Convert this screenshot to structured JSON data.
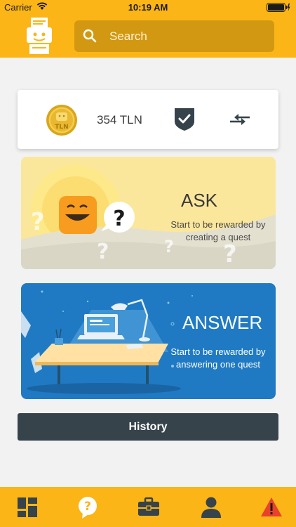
{
  "status_bar": {
    "carrier": "Carrier",
    "time": "10:19 AM"
  },
  "header": {
    "search_placeholder": "Search",
    "logo_icon": "printer-robot-icon"
  },
  "wallet": {
    "balance": "354 TLN",
    "coin_label": "TLN",
    "verified_icon": "shield-check-icon",
    "swap_icon": "swap-arrows-icon"
  },
  "ask": {
    "title": "ASK",
    "subtitle": "Start to be rewarded by creating a quest"
  },
  "answer": {
    "title": "ANSWER",
    "subtitle": "Start to be rewarded by answering one quest"
  },
  "history": {
    "label": "History"
  },
  "tabs": [
    {
      "icon": "dashboard-icon"
    },
    {
      "icon": "question-bubble-icon"
    },
    {
      "icon": "briefcase-icon"
    },
    {
      "icon": "user-icon"
    },
    {
      "icon": "warning-icon"
    }
  ],
  "colors": {
    "brand": "#fbb516",
    "dark": "#36434b",
    "answer_bg": "#1f7ac3",
    "ask_bg": "#fbe79b",
    "alert": "#e8412c"
  }
}
